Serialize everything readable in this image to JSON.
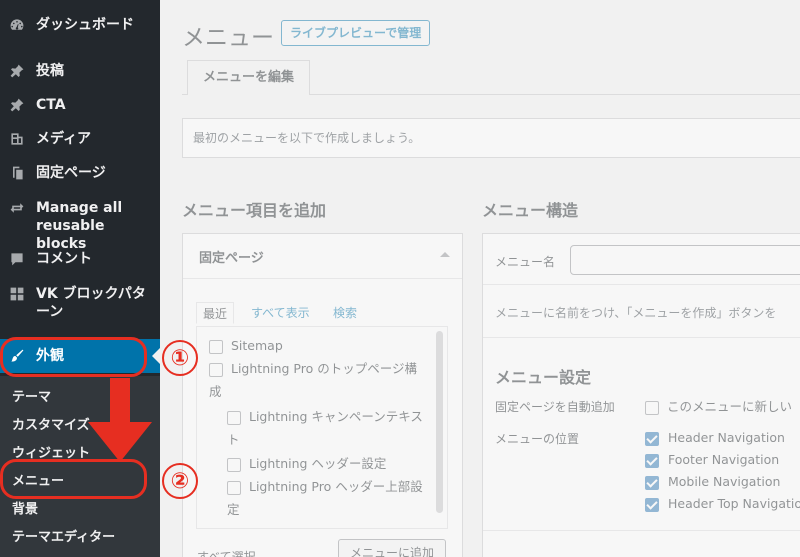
{
  "sidebar": {
    "items": [
      {
        "label": "ダッシュボード",
        "icon": "dashboard-icon"
      },
      {
        "label": "投稿",
        "icon": "pin-icon"
      },
      {
        "label": "CTA",
        "icon": "pin-icon"
      },
      {
        "label": "メディア",
        "icon": "media-icon"
      },
      {
        "label": "固定ページ",
        "icon": "page-icon"
      },
      {
        "label": "Manage all reusable blocks",
        "icon": "loop-icon"
      },
      {
        "label": "コメント",
        "icon": "comment-icon"
      },
      {
        "label": "VK ブロックパターン",
        "icon": "grid-icon"
      },
      {
        "label": "外観",
        "icon": "brush-icon",
        "active": true
      }
    ],
    "submenu": [
      "テーマ",
      "カスタマイズ",
      "ウィジェット",
      "メニュー",
      "背景",
      "テーマエディター"
    ]
  },
  "annotations": {
    "step1": "①",
    "step2": "②",
    "color": "#e62e21"
  },
  "main": {
    "title": "メニュー",
    "live_preview": "ライブプレビューで管理",
    "tab_edit": "メニューを編集",
    "notice": "最初のメニューを以下で作成しましょう。",
    "add_items_heading": "メニュー項目を追加",
    "structure_heading": "メニュー構造",
    "pages_panel": {
      "title": "固定ページ",
      "tabs": [
        "最近",
        "すべて表示",
        "検索"
      ],
      "items": [
        {
          "label": "Sitemap",
          "level": 0
        },
        {
          "label": "Lightning Pro のトップページ構成",
          "level": 0
        },
        {
          "label": "Lightning キャンペーンテキスト",
          "level": 1
        },
        {
          "label": "Lightning ヘッダー設定",
          "level": 1
        },
        {
          "label": "Lightning Pro ヘッダー上部設定",
          "level": 1
        }
      ],
      "select_all": "すべて選択",
      "add_button": "メニューに追加"
    },
    "structure": {
      "menu_name_label": "メニュー名",
      "menu_name_value": "",
      "description": "メニューに名前をつけ、「メニューを作成」ボタンを",
      "settings_heading": "メニュー設定",
      "auto_add_label": "固定ページを自動追加",
      "auto_add_option": "このメニューに新しい",
      "location_label": "メニューの位置",
      "locations": [
        {
          "label": "Header Navigation",
          "checked": true
        },
        {
          "label": "Footer Navigation",
          "checked": true
        },
        {
          "label": "Mobile Navigation",
          "checked": true
        },
        {
          "label": "Header Top Navigation",
          "checked": true
        }
      ]
    }
  },
  "colors": {
    "sidebar_bg": "#23282d",
    "active_bg": "#0073aa",
    "annotation": "#e62e21"
  }
}
